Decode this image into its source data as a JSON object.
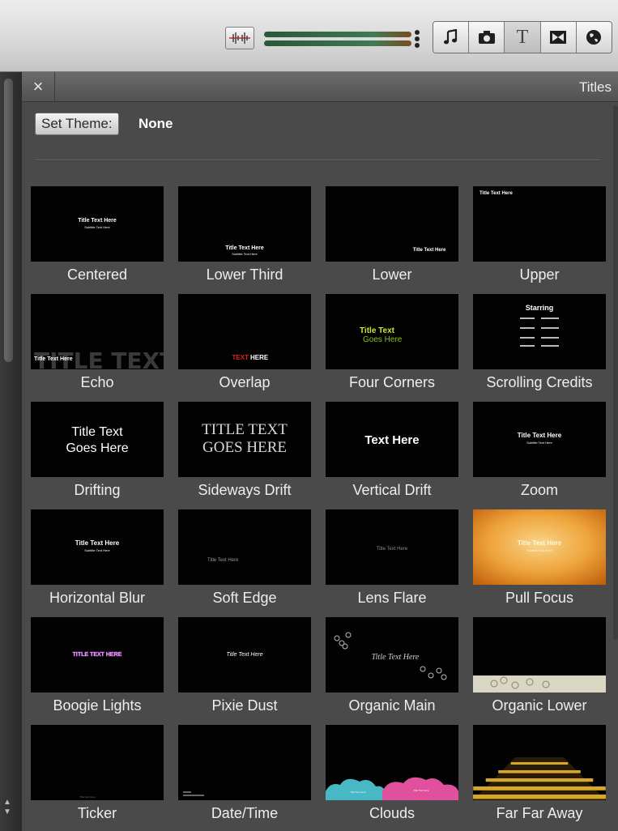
{
  "toolbar": {
    "icons": [
      "audio-adjust-icon",
      "music-icon",
      "camera-icon",
      "titles-icon",
      "transitions-icon",
      "globe-icon"
    ],
    "titles_glyph": "T"
  },
  "panel": {
    "title": "Titles",
    "close_glyph": "×",
    "set_theme_label": "Set Theme:",
    "theme_value": "None"
  },
  "titles": [
    {
      "name": "Centered",
      "line1": "Title Text Here",
      "line2": "Subtitle Text Here"
    },
    {
      "name": "Lower Third",
      "line1": "Title Text Here",
      "line2": "Subtitle Text Here"
    },
    {
      "name": "Lower",
      "line1": "Title Text Here"
    },
    {
      "name": "Upper",
      "line1": "Title Text Here"
    },
    {
      "name": "Echo",
      "line1": "TITLE TEXT HERE",
      "line2": "Title Text Here"
    },
    {
      "name": "Overlap",
      "line1": "TEXT",
      "line2": "HERE"
    },
    {
      "name": "Four Corners",
      "line1": "Title Text",
      "line2": "Goes Here"
    },
    {
      "name": "Scrolling Credits",
      "line1": "Starring"
    },
    {
      "name": "Drifting",
      "line1": "Title Text",
      "line2": "Goes Here"
    },
    {
      "name": "Sideways Drift",
      "line1": "TITLE TEXT",
      "line2": "GOES HERE"
    },
    {
      "name": "Vertical Drift",
      "line1": "Text Here"
    },
    {
      "name": "Zoom",
      "line1": "Title Text Here",
      "line2": "Subtitle Text Here"
    },
    {
      "name": "Horizontal Blur",
      "line1": "Title Text Here",
      "line2": "Subtitle Text Here"
    },
    {
      "name": "Soft Edge",
      "line1": "Title Text Here"
    },
    {
      "name": "Lens Flare",
      "line1": "Title Text Here"
    },
    {
      "name": "Pull Focus",
      "line1": "Title Text Here",
      "line2": "Subtitle Text Here"
    },
    {
      "name": "Boogie Lights",
      "line1": "TITLE TEXT HERE"
    },
    {
      "name": "Pixie Dust",
      "line1": "Title Text Here"
    },
    {
      "name": "Organic Main",
      "line1": "Title Text Here"
    },
    {
      "name": "Organic Lower",
      "line1": ""
    },
    {
      "name": "Ticker",
      "line1": "Title Text Here"
    },
    {
      "name": "Date/Time",
      "line1": ""
    },
    {
      "name": "Clouds",
      "line1": "Title Text Here"
    },
    {
      "name": "Far Far Away",
      "line1": ""
    }
  ]
}
